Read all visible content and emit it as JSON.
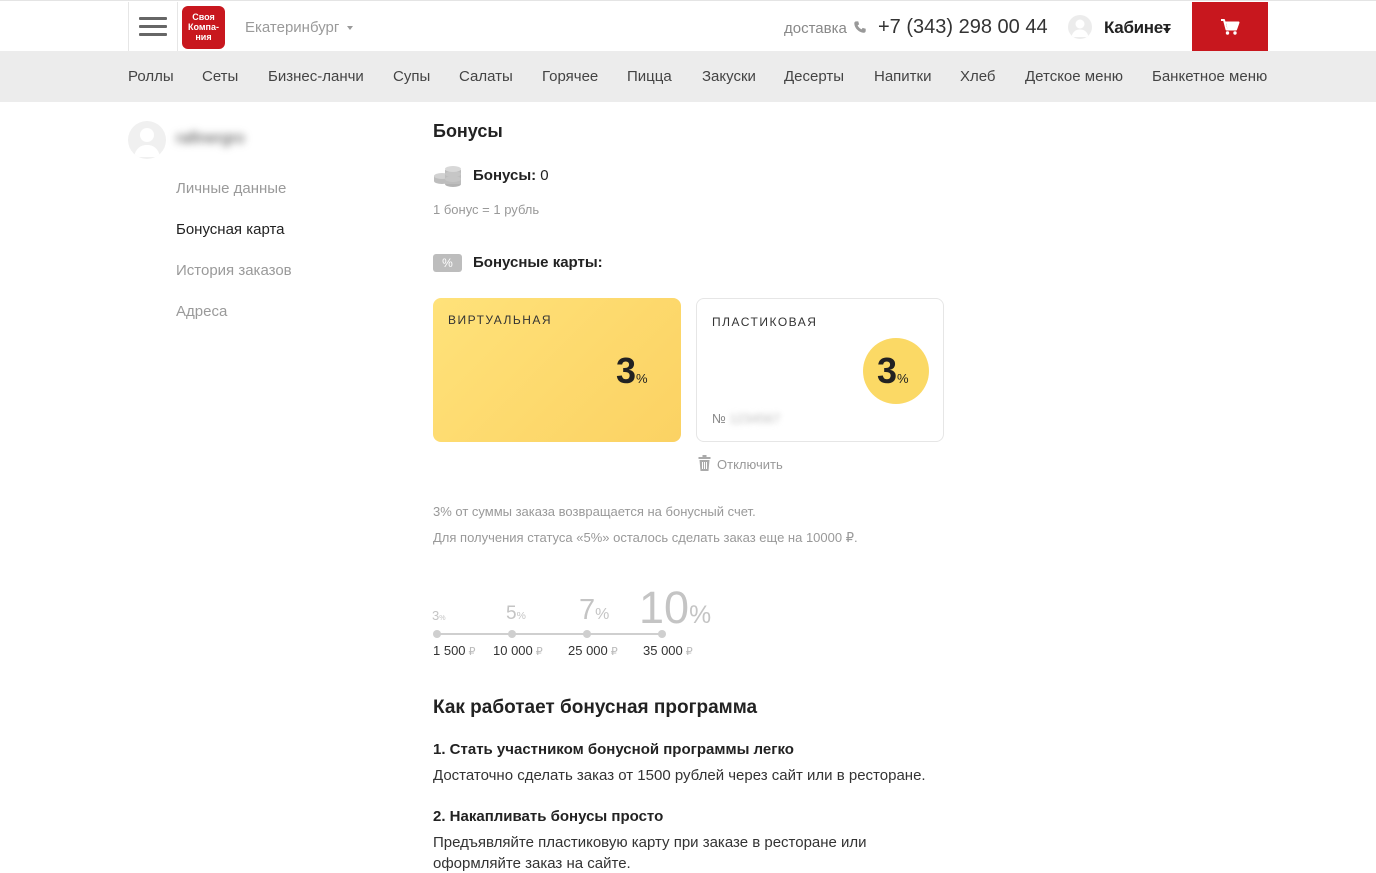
{
  "header": {
    "logo_lines": [
      "Своя",
      "Компа-",
      "ния"
    ],
    "city": "Екатеринбург",
    "delivery_label": "доставка",
    "phone": "+7 (343) 298 00 44",
    "cabinet_label": "Кабинет",
    "colors": {
      "brand": "#c8171e"
    }
  },
  "nav": {
    "items": [
      "Роллы",
      "Сеты",
      "Бизнес-ланчи",
      "Супы",
      "Салаты",
      "Горячее",
      "Пицца",
      "Закуски",
      "Десерты",
      "Напитки",
      "Хлеб",
      "Детское меню",
      "Банкетное меню"
    ]
  },
  "sidebar": {
    "user_name": "rafinergro",
    "items": [
      {
        "label": "Личные данные",
        "active": false
      },
      {
        "label": "Бонусная карта",
        "active": true
      },
      {
        "label": "История заказов",
        "active": false
      },
      {
        "label": "Адреса",
        "active": false
      }
    ]
  },
  "main": {
    "title": "Бонусы",
    "bonus_label": "Бонусы:",
    "bonus_value": "0",
    "bonus_rate": "1 бонус = 1 рубль",
    "cards_title": "Бонусные карты:",
    "pct_icon": "%",
    "virtual_card": {
      "title": "ВИРТУАЛЬНАЯ",
      "value": "3",
      "unit": "%"
    },
    "plastic_card": {
      "title": "ПЛАСТИКОВАЯ",
      "value": "3",
      "unit": "%",
      "number_label": "№",
      "number_value": "1234567"
    },
    "disable_label": "Отключить",
    "info_1": "3% от суммы заказа возвращается на бонусный счет.",
    "info_2": "Для получения статуса «5%» осталось сделать заказ еще на 10000 ₽.",
    "levels": [
      {
        "value": "3",
        "unit": "%",
        "amount": "1 500"
      },
      {
        "value": "5",
        "unit": "%",
        "amount": "10 000"
      },
      {
        "value": "7",
        "unit": "%",
        "amount": "25 000"
      },
      {
        "value": "10",
        "unit": "%",
        "amount": "35 000"
      }
    ],
    "currency": "₽",
    "how_title": "Как работает бонусная программа",
    "steps": [
      {
        "title": "1. Стать участником бонусной программы легко",
        "text": "Достаточно сделать заказ от 1500 рублей через сайт или в ресторане."
      },
      {
        "title": "2. Накапливать бонусы просто",
        "text": "Предъявляйте пластиковую карту при заказе в ресторане или оформляйте заказ на сайте."
      }
    ]
  }
}
